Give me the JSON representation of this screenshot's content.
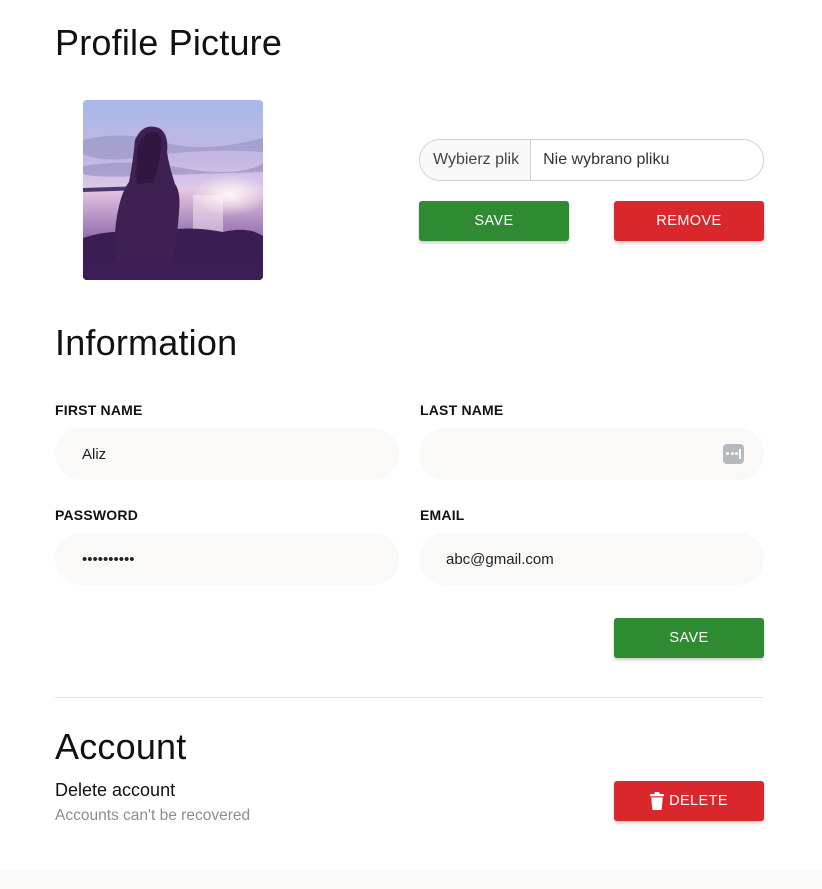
{
  "profile": {
    "title": "Profile Picture",
    "file_button_label": "Wybierz plik",
    "file_status": "Nie wybrano pliku",
    "save_label": "SAVE",
    "remove_label": "REMOVE"
  },
  "information": {
    "title": "Information",
    "first_name_label": "FIRST NAME",
    "first_name_value": "Aliz",
    "last_name_label": "LAST NAME",
    "last_name_value": "",
    "password_label": "PASSWORD",
    "password_value": "••••••••••",
    "email_label": "EMAIL",
    "email_value": "abc@gmail.com",
    "save_label": "SAVE"
  },
  "account": {
    "title": "Account",
    "delete_title": "Delete account",
    "delete_subtitle": "Accounts can't be recovered",
    "delete_label": "DELETE"
  },
  "colors": {
    "save_green": "#2e8b32",
    "remove_red": "#d9272b"
  },
  "icons": {
    "trash": "trash-icon",
    "password_manager": "password-manager-icon"
  }
}
